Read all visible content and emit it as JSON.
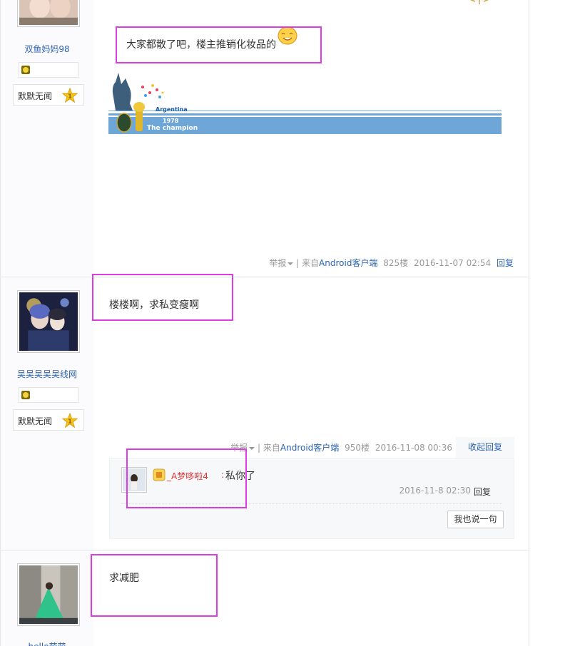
{
  "posts": [
    {
      "username": "双鱼妈妈98",
      "rank_label": "默默无闻",
      "rank_level": "1",
      "content": "大家都散了吧，楼主推销化妆品的",
      "signature": {
        "country": "Argentina",
        "year": "1978",
        "caption": "The champion"
      },
      "tail": {
        "report": "举报",
        "sep": "|",
        "from_prefix": "来自",
        "source": "Android客户端",
        "floor": "825楼",
        "time": "2016-11-07 02:54",
        "reply": "回复"
      }
    },
    {
      "username": "吴吴吴吴吴线网",
      "rank_label": "默默无闻",
      "rank_level": "1",
      "content": "楼楼啊，求私变瘦啊",
      "tail": {
        "report": "举报",
        "sep": "|",
        "from_prefix": "来自",
        "source": "Android客户端",
        "floor": "950楼",
        "time": "2016-11-08 00:36",
        "collapse": "收起回复"
      },
      "sub_reply": {
        "user": "_A梦哆啦4",
        "colon": ":",
        "text": "私你了",
        "time": "2016-11-8 02:30",
        "reply": "回复",
        "say_button": "我也说一句"
      }
    },
    {
      "username": "hello萌萌",
      "content": "求减肥"
    }
  ],
  "colors": {
    "highlight": "#dd3ce0",
    "link": "#2d64b3",
    "signature_bar": "#6fa6d8"
  }
}
